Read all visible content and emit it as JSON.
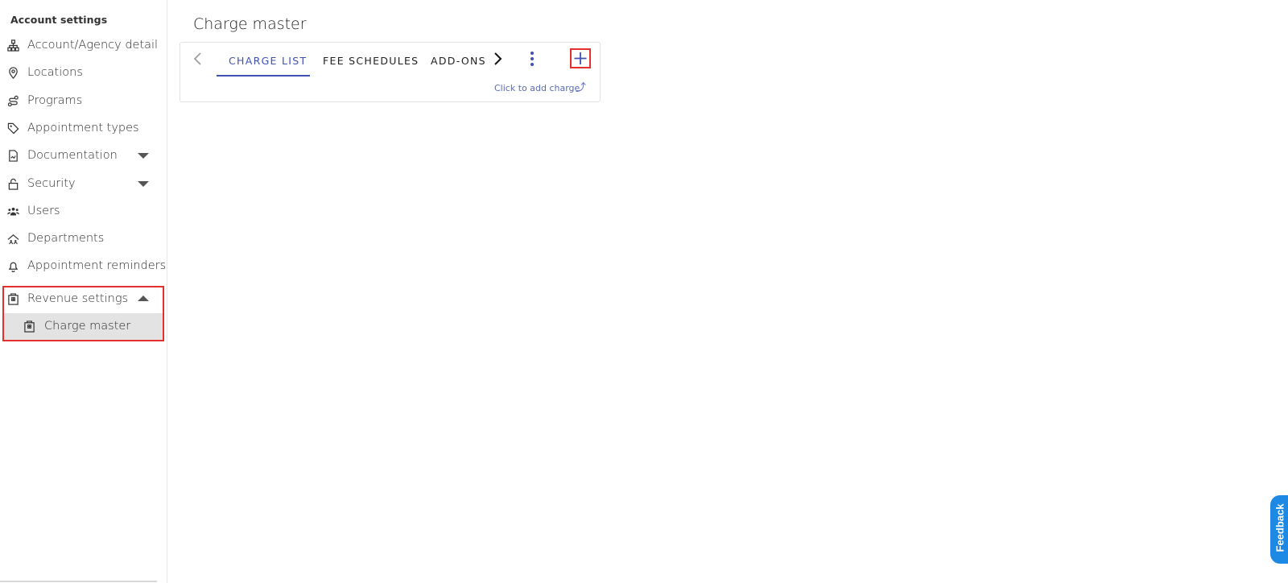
{
  "sidebar": {
    "heading": "Account settings",
    "items": [
      {
        "label": "Account/Agency detail",
        "icon": "org-chart-icon"
      },
      {
        "label": "Locations",
        "icon": "location-pin-icon"
      },
      {
        "label": "Programs",
        "icon": "route-icon"
      },
      {
        "label": "Appointment types",
        "icon": "tag-icon"
      },
      {
        "label": "Documentation",
        "icon": "document-icon",
        "expandable": true
      },
      {
        "label": "Security",
        "icon": "lock-icon",
        "expandable": true
      },
      {
        "label": "Users",
        "icon": "users-icon"
      },
      {
        "label": "Departments",
        "icon": "departments-icon"
      },
      {
        "label": "Appointment reminders",
        "icon": "bell-icon"
      },
      {
        "label": "Revenue settings",
        "icon": "building-icon",
        "expanded": true
      }
    ],
    "subitems": [
      {
        "label": "Charge master",
        "icon": "building-icon",
        "selected": true
      }
    ]
  },
  "main": {
    "title": "Charge master",
    "tabs": [
      {
        "label": "CHARGE LIST",
        "active": true
      },
      {
        "label": "FEE SCHEDULES",
        "active": false
      },
      {
        "label": "ADD-ONS",
        "active": false
      }
    ],
    "add_hint": "Click to add charge"
  },
  "feedback": {
    "label": "Feedback"
  },
  "colors": {
    "accent": "#3f51b5",
    "highlight": "#e53030",
    "feedback": "#1e88e5",
    "selected_bg": "#e3e3e3"
  }
}
